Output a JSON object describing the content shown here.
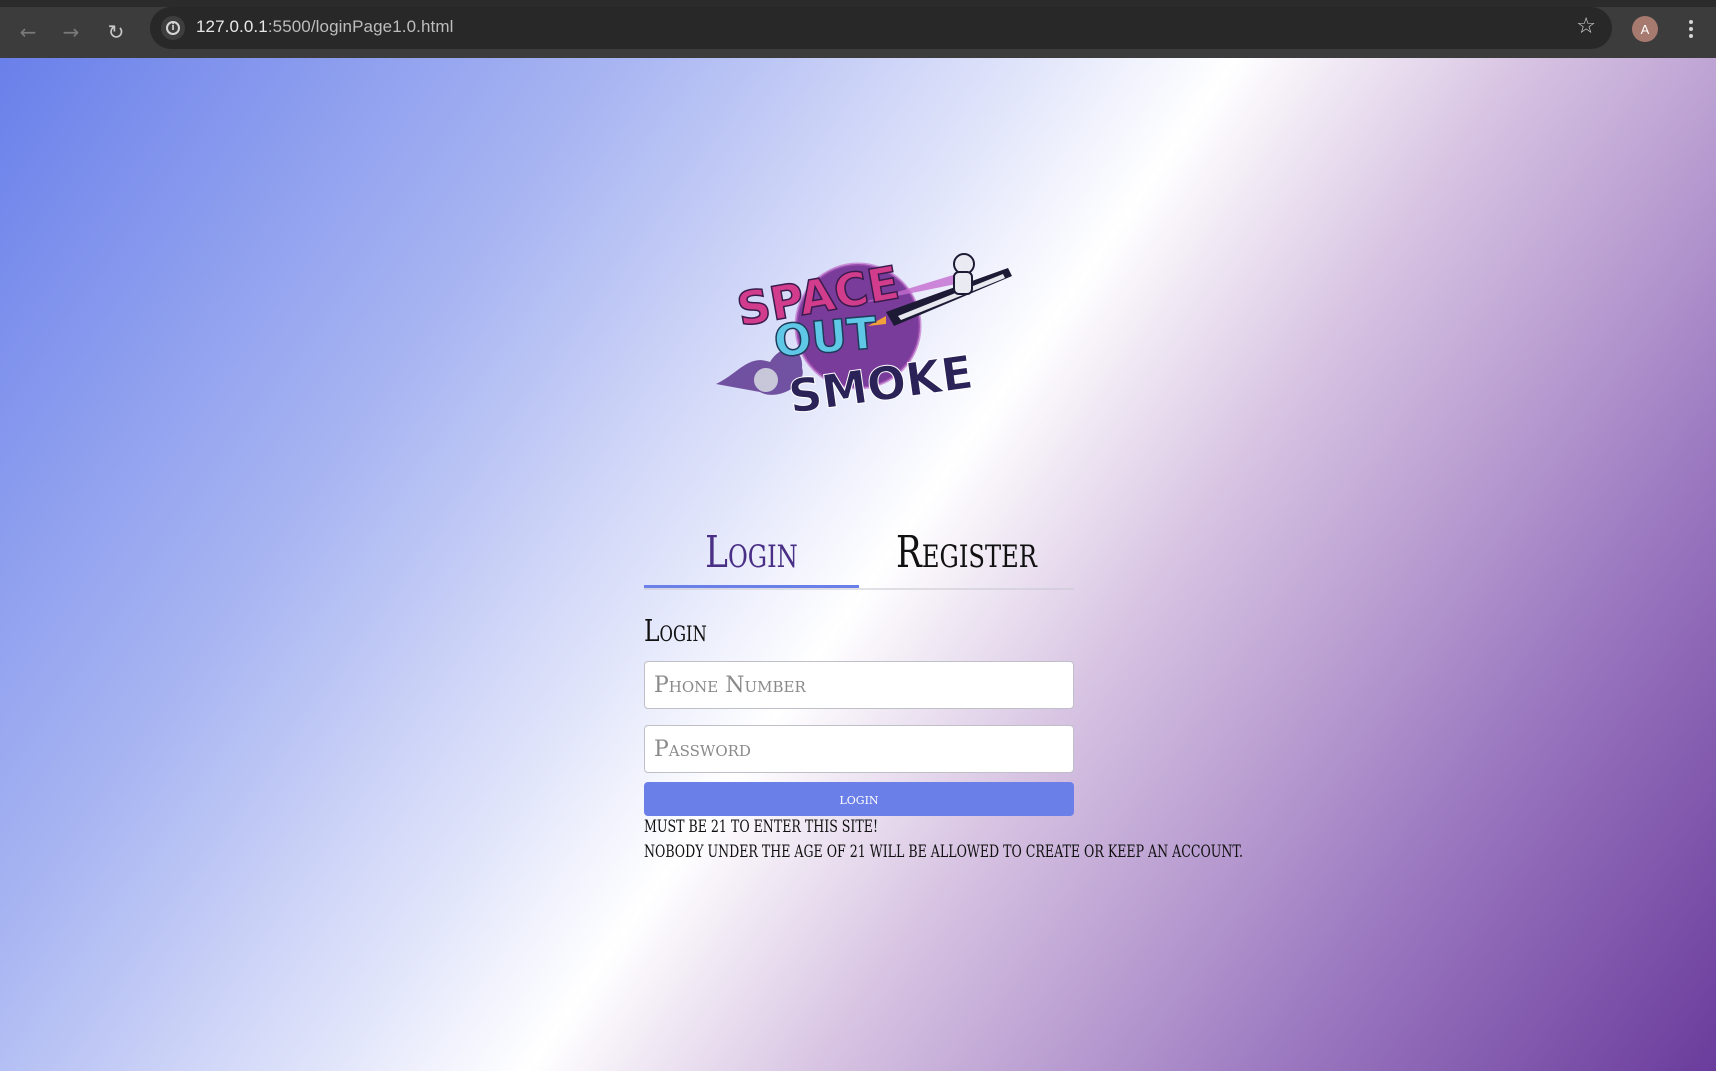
{
  "browser": {
    "url_host": "127.0.0.1",
    "url_path": ":5500/loginPage1.0.html",
    "profile_initial": "A",
    "icons": {
      "back": "arrow-left-icon",
      "forward": "arrow-right-icon",
      "reload": "reload-icon",
      "site_info": "info-icon",
      "bookmark": "star-icon",
      "menu": "kebab-menu-icon"
    }
  },
  "logo": {
    "line1": "SPACE",
    "line2": "OUT",
    "line3": "SMOKE"
  },
  "tabs": [
    {
      "label": "Login",
      "active": true
    },
    {
      "label": "Register",
      "active": false
    }
  ],
  "form": {
    "title": "Login",
    "phone_placeholder": "Phone Number",
    "password_placeholder": "Password",
    "submit_label": "login"
  },
  "notices": {
    "line1": "MUST BE 21 TO ENTER THIS SITE!",
    "line2": "NOBODY UNDER THE AGE OF 21 WILL BE ALLOWED TO CREATE OR KEEP AN ACCOUNT."
  },
  "colors": {
    "accent": "#6b7fe8",
    "active_tab_text": "#4a2f86",
    "gradient_start": "#6a80ea",
    "gradient_end": "#6a3c9c",
    "logo_pink": "#d23c8c",
    "logo_cyan": "#5ec8e6",
    "logo_navy": "#2b2258"
  }
}
